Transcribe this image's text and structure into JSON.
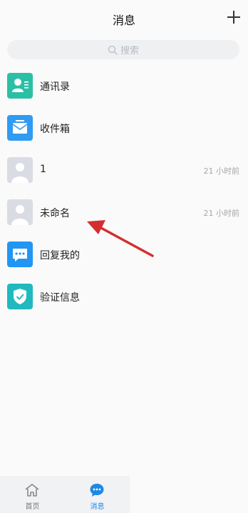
{
  "header": {
    "title": "消息",
    "add_icon": "plus-icon"
  },
  "search": {
    "placeholder": "搜索",
    "icon": "search-icon"
  },
  "list": [
    {
      "icon": "contacts-icon",
      "label": "通讯录",
      "time": ""
    },
    {
      "icon": "inbox-icon",
      "label": "收件箱",
      "time": ""
    },
    {
      "icon": "default-avatar-icon",
      "label": "1",
      "time": "21 小时前"
    },
    {
      "icon": "default-avatar-icon",
      "label": "未命名",
      "time": "21 小时前"
    },
    {
      "icon": "reply-chat-icon",
      "label": "回复我的",
      "time": ""
    },
    {
      "icon": "verify-shield-icon",
      "label": "验证信息",
      "time": ""
    }
  ],
  "tabbar": {
    "items": [
      {
        "label": "首页",
        "icon": "home-icon",
        "active": false
      },
      {
        "label": "消息",
        "icon": "chat-bubble-icon",
        "active": true
      }
    ]
  },
  "colors": {
    "accent_blue": "#1e88e5",
    "contacts_teal": "#2bbfa6",
    "verify_teal": "#1fb9bf",
    "annotation_red": "#d32f2f"
  }
}
